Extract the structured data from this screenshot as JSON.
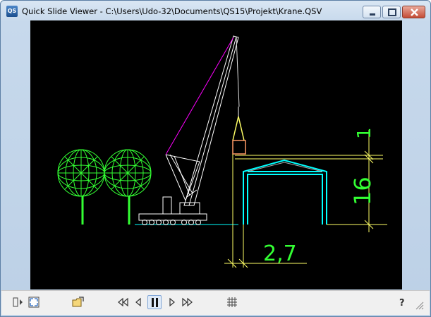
{
  "window": {
    "app_icon_text": "QS",
    "title": "Quick Slide Viewer - C:\\Users\\Udo-32\\Documents\\QS15\\Projekt\\Krane.QSV"
  },
  "drawing": {
    "dimension_width": "2,7",
    "dimension_height": "16",
    "dimension_top": "1"
  },
  "toolbar": {
    "icons": [
      "show-panel-icon",
      "fullscreen-icon",
      "open-folder-icon",
      "first-slide-icon",
      "previous-slide-icon",
      "pause-icon",
      "next-slide-icon",
      "last-slide-icon",
      "grid-icon",
      "help-icon",
      "resize-grip-icon"
    ]
  },
  "colors": {
    "canvas_bg": "#000000",
    "tree": "#33ff33",
    "crane": "#ffffff",
    "boom_line": "#ff00ff",
    "hall": "#00ffff",
    "dimensions": "#ffff66",
    "dim_text": "#33ff33"
  }
}
